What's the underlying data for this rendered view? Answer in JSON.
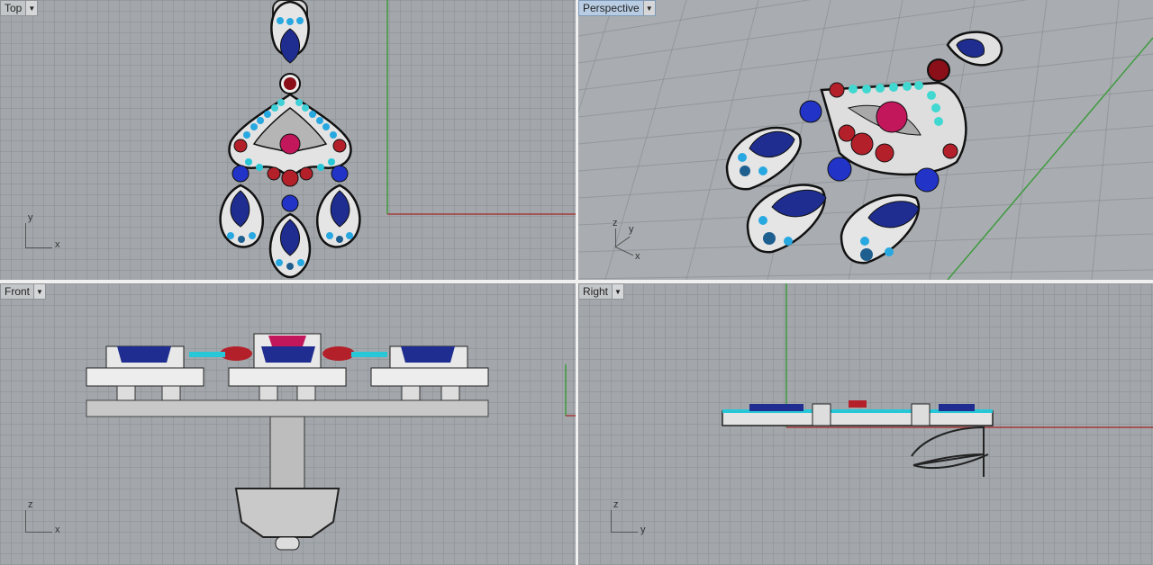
{
  "viewports": {
    "top": {
      "label": "Top"
    },
    "persp": {
      "label": "Perspective"
    },
    "front": {
      "label": "Front"
    },
    "right": {
      "label": "Right"
    }
  },
  "axes": {
    "top": {
      "h": "x",
      "v": "y"
    },
    "persp": {
      "a": "z",
      "b": "y",
      "c": "x"
    },
    "front": {
      "h": "x",
      "v": "z"
    },
    "right": {
      "h": "y",
      "v": "z"
    }
  },
  "icons": {
    "dropdown": "chevron-down-icon"
  },
  "colors": {
    "viewport_bg": "#a3a7ab",
    "x_axis": "#a33a3a",
    "y_axis": "#3f9a3f",
    "sapphire": "#1e2d8f",
    "ruby": "#b3202a",
    "aqua": "#28c7d8",
    "metal": "#e6e6e6"
  }
}
